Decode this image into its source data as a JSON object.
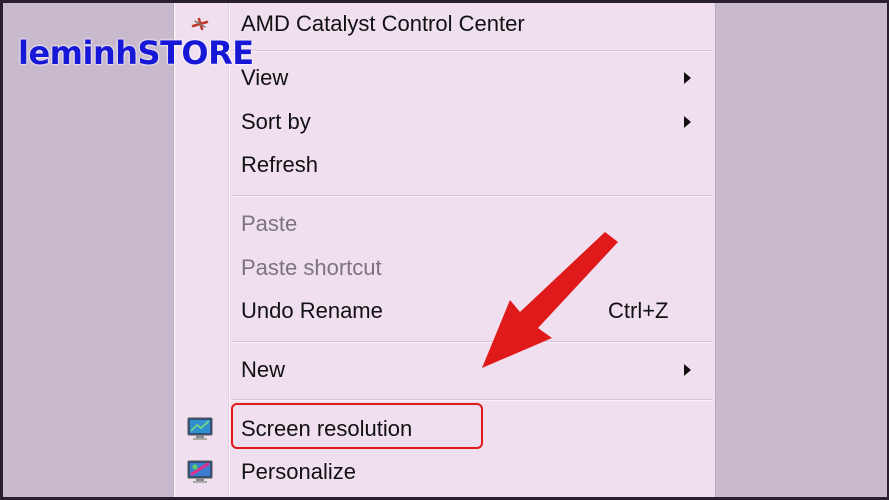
{
  "watermark": "leminhSTORE",
  "menu": {
    "amd": "AMD Catalyst Control Center",
    "view": "View",
    "sort_by": "Sort by",
    "refresh": "Refresh",
    "paste": "Paste",
    "paste_shortcut": "Paste shortcut",
    "undo_rename": "Undo Rename",
    "undo_shortcut": "Ctrl+Z",
    "new": "New",
    "screen_resolution": "Screen resolution",
    "personalize": "Personalize"
  },
  "colors": {
    "menu_bg": "#efdfef",
    "annotation_red": "#e01a1a",
    "watermark_blue": "#1717d8"
  }
}
